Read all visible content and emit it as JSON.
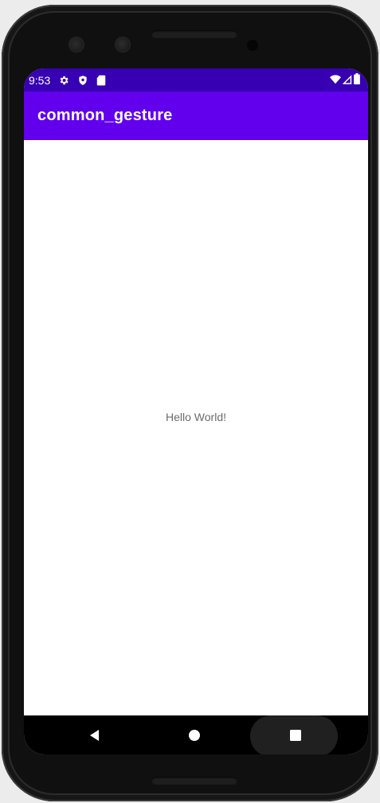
{
  "device": {
    "frame": "android-phone"
  },
  "status_bar": {
    "time": "9:53",
    "left_icons": [
      "settings-icon",
      "shield-icon",
      "sd-card-icon"
    ],
    "right_icons": [
      "wifi-icon",
      "signal-icon",
      "battery-icon"
    ],
    "background_color": "#3700b3"
  },
  "app_bar": {
    "title": "common_gesture",
    "background_color": "#6200ee"
  },
  "content": {
    "message": "Hello World!"
  },
  "nav_bar": {
    "buttons": [
      "back-icon",
      "home-icon",
      "recents-icon"
    ]
  }
}
